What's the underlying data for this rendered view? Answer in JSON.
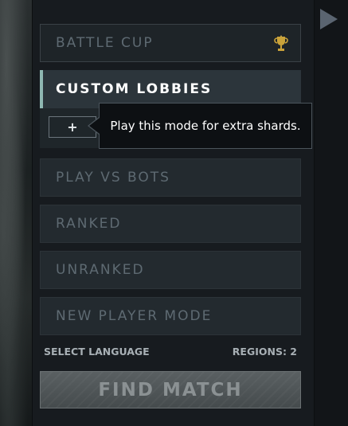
{
  "modes": {
    "battle_cup": "BATTLE CUP",
    "custom_lobbies": "CUSTOM LOBBIES",
    "play_vs_bots": "PLAY VS BOTS",
    "ranked": "RANKED",
    "unranked": "UNRANKED",
    "new_player_mode": "NEW PLAYER MODE"
  },
  "custom_lobbies_sub": {
    "plus_label": "+"
  },
  "tooltip": {
    "text": "Play this mode for extra shards."
  },
  "footer": {
    "select_language": "SELECT LANGUAGE",
    "regions": "REGIONS: 2"
  },
  "find_match": {
    "label": "FIND MATCH"
  },
  "icons": {
    "trophy": "trophy-icon",
    "play": "play-arrow-icon"
  },
  "colors": {
    "accent_teal": "#8fb8b2",
    "trophy_gold": "#c9a23a"
  }
}
